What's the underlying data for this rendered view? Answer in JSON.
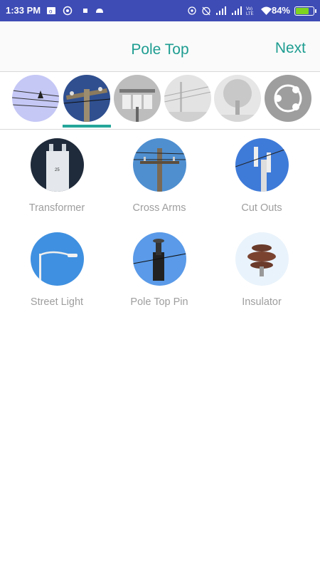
{
  "status_bar": {
    "time": "1:33 PM",
    "battery_percent": "84%",
    "battery_level": 0.84,
    "icons": [
      "outlook-icon",
      "whatsapp-icon",
      "stop-icon",
      "android-icon",
      "hotspot-icon",
      "alarm-off-icon",
      "signal-icon",
      "signal-icon",
      "volte-icon",
      "wifi-icon",
      "battery-icon"
    ]
  },
  "app_bar": {
    "title": "Pole Top",
    "next_label": "Next"
  },
  "categories": {
    "selected_index": 1,
    "items": [
      {
        "name": "wires"
      },
      {
        "name": "pole-top"
      },
      {
        "name": "transformer-bank"
      },
      {
        "name": "line"
      },
      {
        "name": "tree"
      },
      {
        "name": "share"
      }
    ]
  },
  "grid": {
    "items": [
      {
        "label": "Transformer"
      },
      {
        "label": "Cross Arms"
      },
      {
        "label": "Cut Outs"
      },
      {
        "label": "Street Light"
      },
      {
        "label": "Pole Top Pin"
      },
      {
        "label": "Insulator"
      }
    ]
  },
  "colors": {
    "status_bar": "#3e4cb5",
    "accent": "#1e9d91",
    "tab_indicator": "#26a69a",
    "label": "#9e9e9e"
  }
}
